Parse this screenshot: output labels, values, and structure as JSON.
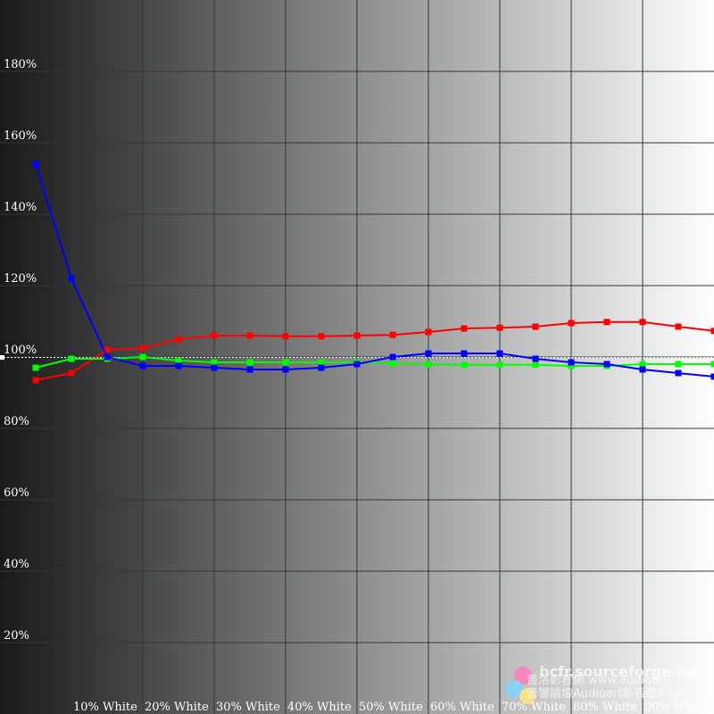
{
  "chart_data": {
    "type": "line",
    "x": [
      "0%",
      "5%",
      "10%",
      "15%",
      "20%",
      "25%",
      "30%",
      "35%",
      "40%",
      "45%",
      "50%",
      "55%",
      "60%",
      "65%",
      "70%",
      "75%",
      "80%",
      "85%",
      "90%",
      "95%",
      "100%"
    ],
    "x_tick_labels": [
      "10% White",
      "20% White",
      "30% White",
      "40% White",
      "50% White",
      "60% White",
      "70% White",
      "80% White",
      "90% White"
    ],
    "y_tick_labels": [
      "20%",
      "40%",
      "60%",
      "80%",
      "100%",
      "120%",
      "140%",
      "160%",
      "180%"
    ],
    "ylim": [
      0,
      200
    ],
    "reference_line": 100,
    "grid": true,
    "legend": "none",
    "background": "grayscale gradient from black (left) to white (right)",
    "series": [
      {
        "color": "#ff0000",
        "values": [
          93.5,
          95.5,
          102,
          102.5,
          105,
          106,
          106,
          105.8,
          105.8,
          106,
          106.2,
          107,
          108,
          108.2,
          108.5,
          109.5,
          109.8,
          109.8,
          108.5,
          107.3
        ]
      },
      {
        "color": "#00ff00",
        "values": [
          97,
          99.5,
          99.5,
          100,
          99,
          98.5,
          98.5,
          98.5,
          98.5,
          98.5,
          98.2,
          98,
          97.8,
          97.8,
          97.8,
          97.5,
          97.5,
          98,
          98,
          98,
          98.5
        ]
      },
      {
        "color": "#0000ff",
        "values": [
          154,
          122,
          100,
          97.5,
          97.5,
          97,
          96.5,
          96.5,
          97,
          98,
          100,
          101,
          101,
          101,
          99.5,
          98.5,
          98,
          96.5,
          95.5,
          94.5,
          93
        ]
      }
    ]
  },
  "watermark": {
    "line1": "hcfr.sourceforge.net",
    "line2": "普洛影音網 www.audioart",
    "line3": "音響論壇Audioart新視聽Prime",
    "logo": "colored-circles-logo"
  }
}
